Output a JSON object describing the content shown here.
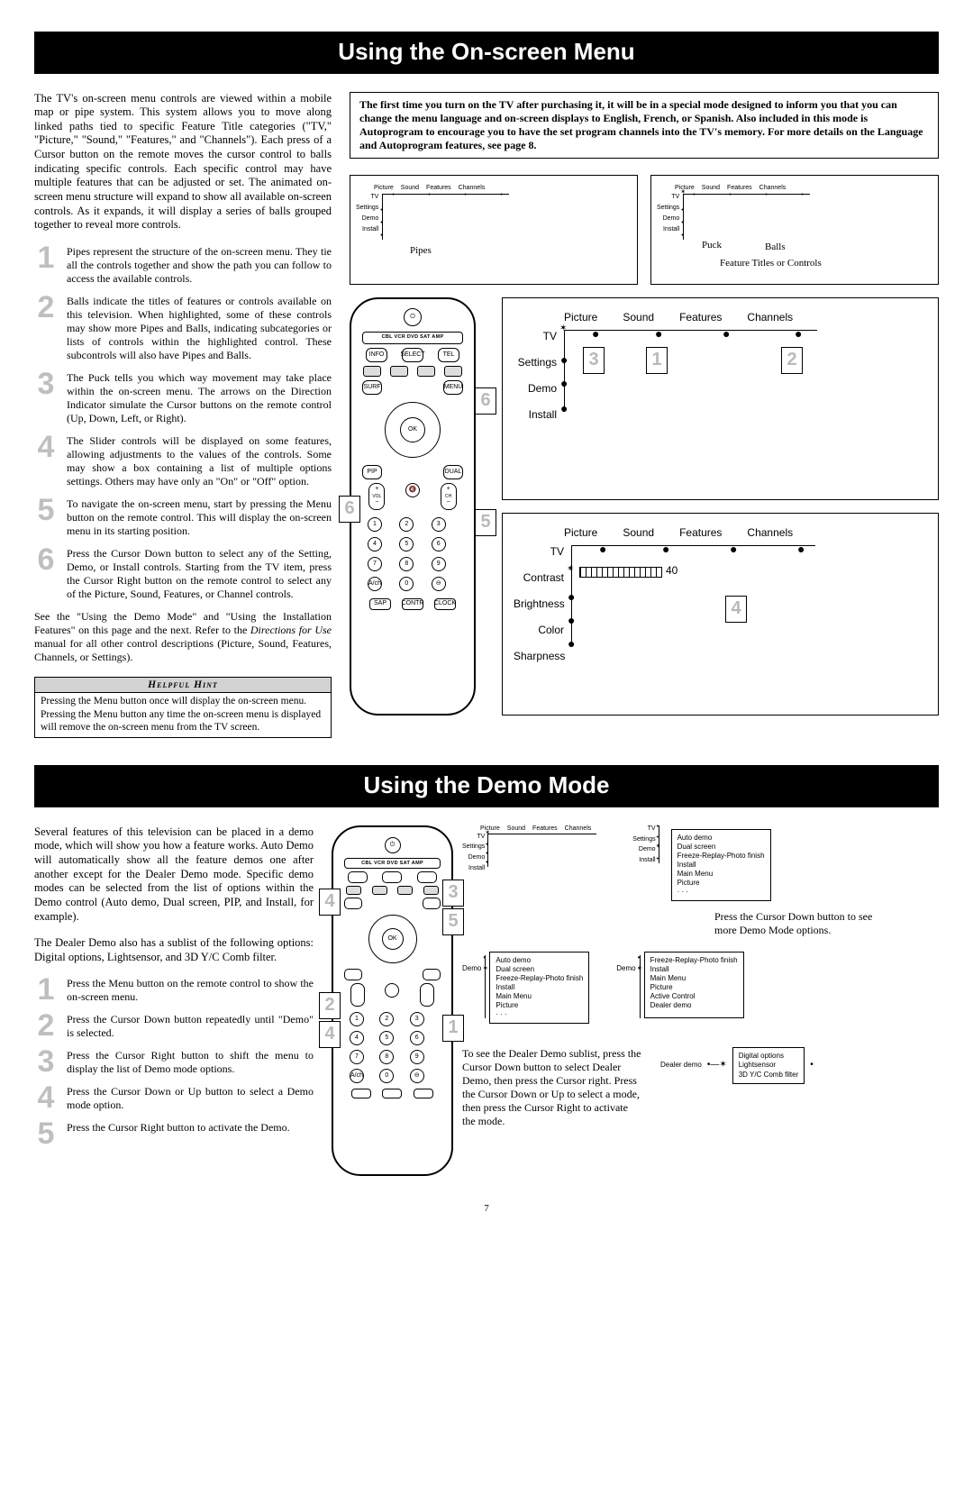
{
  "page_number": "7",
  "section1": {
    "title": "Using the On-screen Menu",
    "intro": "The TV's on-screen menu controls are viewed within a mobile map or pipe system. This system allows you to move along linked paths tied to specific Feature Title categories (\"TV,\" \"Picture,\" \"Sound,\" \"Features,\" and \"Channels\"). Each press of a Cursor button on the remote moves the cursor control to balls indicating specific controls. Each specific control may have multiple features that can be adjusted or set. The animated on-screen menu structure will expand to show all available on-screen controls. As it expands, it will display a series of balls grouped together to reveal more controls.",
    "steps": [
      "Pipes represent the structure of the on-screen menu. They tie all the controls together and show the path you can follow to access the available controls.",
      "Balls indicate the titles of features or controls available on this television. When highlighted, some of these controls may show more Pipes and Balls, indicating subcategories or lists of controls within the highlighted control. These subcontrols will also have Pipes and Balls.",
      "The Puck tells you which way movement may take place within the on-screen menu. The arrows on the Direction Indicator simulate the Cursor buttons on the remote control (Up, Down, Left, or Right).",
      "The Slider controls will be displayed on some features, allowing adjustments to the values of the controls. Some may show a box containing a list of multiple options settings. Others may have only an \"On\" or \"Off\" option.",
      "To navigate the on-screen menu, start by pressing the Menu button on the remote control. This will display the on-screen menu in its starting position.",
      "Press the Cursor Down button to select any of the Setting, Demo, or Install controls. Starting from the TV item, press the Cursor Right button on the remote control to select any of the Picture, Sound, Features, or Channel controls."
    ],
    "after_note": "See the \"Using the Demo Mode\" and \"Using the Installation Features\" on this page and the next. Refer to the Directions for Use manual for all other control descriptions (Picture, Sound, Features, Channels, or Settings).",
    "hint_title": "Helpful Hint",
    "hint_body": "Pressing the Menu button once will display the on-screen menu. Pressing the Menu button any time the on-screen menu is displayed will remove the on-screen menu from the TV screen.",
    "callout": "The first time you turn on the TV after purchasing it, it will be in a special mode designed to inform you that you can change the menu language and on-screen displays to English, French, or Spanish. Also included in this mode is Autoprogram to encourage you to have the set program channels into the TV's memory. For more details on the Language and Autoprogram features, see page 8.",
    "menu_labels": {
      "tv": "TV",
      "settings": "Settings",
      "demo": "Demo",
      "install": "Install",
      "picture": "Picture",
      "sound": "Sound",
      "features": "Features",
      "channels": "Channels",
      "pipes": "Pipes",
      "balls": "Balls",
      "puck": "Puck",
      "feature_titles": "Feature Titles or Controls",
      "contrast": "Contrast",
      "brightness": "Brightness",
      "color": "Color",
      "sharpness": "Sharpness",
      "contrast_val": "40"
    },
    "remote_labels": {
      "strip": "CBL VCR DVD SAT AMP",
      "ok": "OK"
    }
  },
  "section2": {
    "title": "Using the Demo Mode",
    "intro1": "Several features of this television can be placed in a demo mode, which will show you how a feature works. Auto Demo will automatically show all the feature demos one after another except for the Dealer Demo mode. Specific demo modes can be selected from the list of options within the Demo control (Auto demo, Dual screen, PIP, and Install, for example).",
    "intro2": "The Dealer Demo also has a sublist of the following options: Digital options, Lightsensor, and 3D Y/C Comb filter.",
    "steps": [
      "Press the Menu button on the remote control to show the on-screen menu.",
      "Press the Cursor Down button repeatedly until \"Demo\" is selected.",
      "Press the Cursor Right button to shift the menu to display the list of Demo mode options.",
      "Press the Cursor Down or Up button to select a Demo mode option.",
      "Press the Cursor Right button to activate the Demo."
    ],
    "note1": "Press the Cursor Down button to see more Demo Mode options.",
    "note2": "To see the Dealer Demo sublist, press the Cursor Down button to select Dealer Demo, then press the Cursor right. Press the Cursor Down or Up to select a mode, then press the Cursor Right to activate the mode.",
    "demo_list": [
      "Auto demo",
      "Dual screen",
      "Freeze-Replay-Photo finish",
      "Install",
      "Main Menu",
      "Picture",
      "· · ·"
    ],
    "demo_list2": [
      "Install",
      "Main Menu",
      "Picture",
      "Active Control",
      "Dealer demo"
    ],
    "demo_list2_pre": "Freeze-Replay-Photo finish",
    "dealer_sub": [
      "Digital options",
      "Lightsensor",
      "3D Y/C Comb filter"
    ],
    "dealer_label": "Dealer demo",
    "demo_label": "Demo"
  }
}
